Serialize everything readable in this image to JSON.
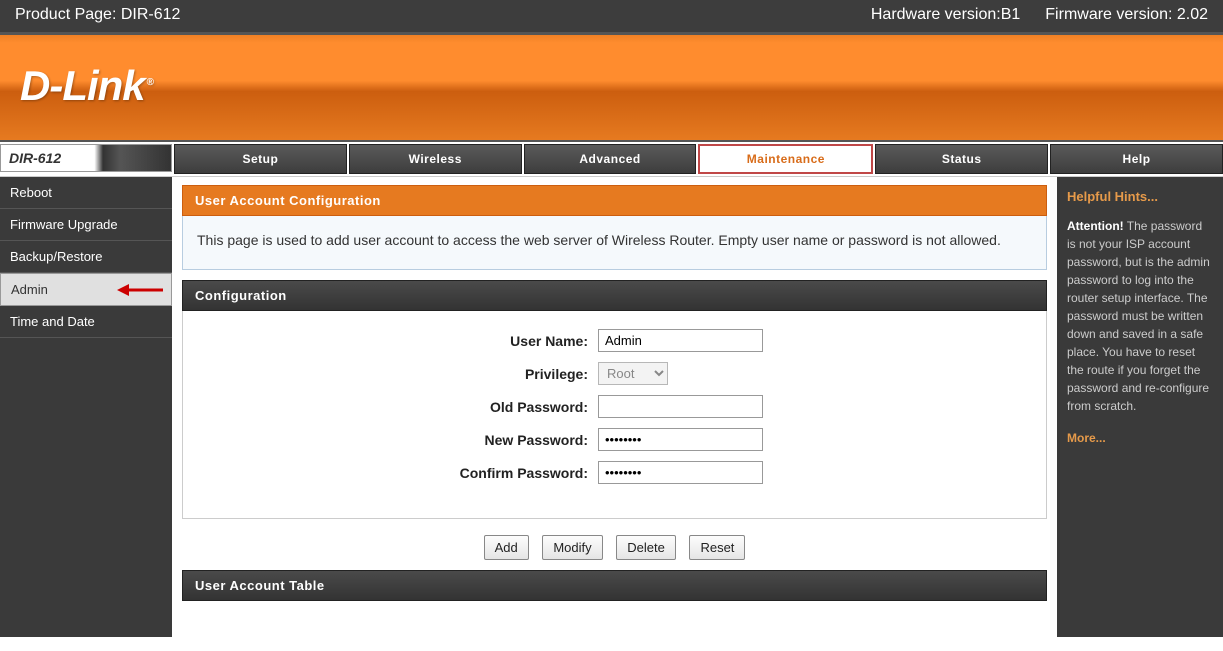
{
  "topbar": {
    "product": "Product Page: DIR-612",
    "hardware": "Hardware version:B1",
    "firmware": "Firmware version: 2.02"
  },
  "logo": "D-Link",
  "model": "DIR-612",
  "tabs": {
    "setup": "Setup",
    "wireless": "Wireless",
    "advanced": "Advanced",
    "maintenance": "Maintenance",
    "status": "Status",
    "help": "Help"
  },
  "sidebar": {
    "reboot": "Reboot",
    "firmware": "Firmware Upgrade",
    "backup": "Backup/Restore",
    "admin": "Admin",
    "time": "Time and Date"
  },
  "section": {
    "title": "User Account Configuration",
    "desc": "This page is used to add user account to access the web server of Wireless Router. Empty user name or password is not allowed."
  },
  "config": {
    "title": "Configuration",
    "labels": {
      "username": "User Name:",
      "privilege": "Privilege:",
      "oldpass": "Old Password:",
      "newpass": "New Password:",
      "confirm": "Confirm Password:"
    },
    "values": {
      "username": "Admin",
      "privilege": "Root",
      "oldpass": "",
      "newpass": "••••••••",
      "confirm": "••••••••"
    }
  },
  "buttons": {
    "add": "Add",
    "modify": "Modify",
    "delete": "Delete",
    "reset": "Reset"
  },
  "table": {
    "title": "User Account Table"
  },
  "hints": {
    "title": "Helpful Hints...",
    "attention": "Attention!",
    "body": " The password is not your ISP account password, but is the admin password to log into the router setup interface. The password must be written down and saved in a safe place. You have to reset the route if you forget the password and re-configure from scratch.",
    "more": "More..."
  }
}
